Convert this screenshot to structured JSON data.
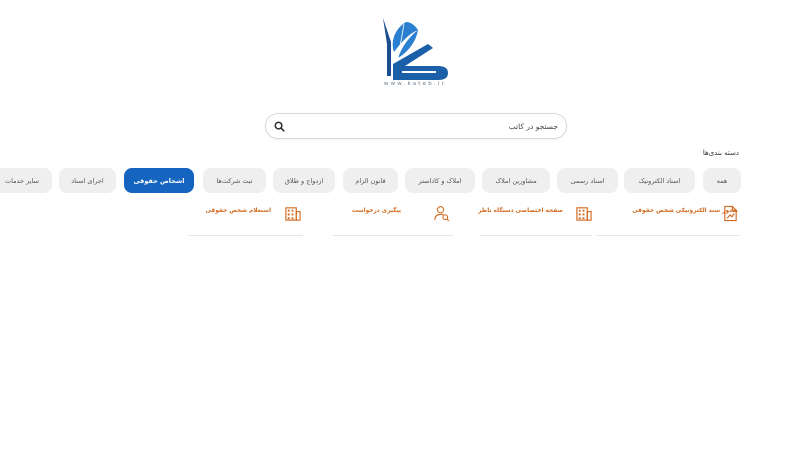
{
  "logo": {
    "url_text": "www.kateb.ir"
  },
  "search": {
    "placeholder": "جستجو در کاتب"
  },
  "categories": {
    "title": "دسته بندی‌ها",
    "chips": [
      {
        "label": "همه"
      },
      {
        "label": "اسناد الکترونیک"
      },
      {
        "label": "اسناد رسمی"
      },
      {
        "label": "مشاورین املاک"
      },
      {
        "label": "املاک و کاداستر"
      },
      {
        "label": "قانون الزام"
      },
      {
        "label": "ازدواج و طلاق"
      },
      {
        "label": "ثبت شرکت‌ها"
      },
      {
        "label": "اشخاص حقوقی",
        "active": true
      },
      {
        "label": "اجرای اسناد"
      },
      {
        "label": "سایر خدمات"
      }
    ]
  },
  "services": [
    {
      "label": "صدور سند الکترونیکی شخص حقوقی",
      "icon": "document-edit-icon"
    },
    {
      "label": "صفحه اختصاصی دستگاه ناظر",
      "icon": "building-icon"
    },
    {
      "label": "پیگیری درخواست",
      "icon": "user-search-icon"
    },
    {
      "label": "استعلام شخص حقوقی",
      "icon": "building-icon"
    }
  ],
  "colors": {
    "accent": "#1565c0",
    "service_text": "#d2691e",
    "chip_bg": "#efefef"
  }
}
